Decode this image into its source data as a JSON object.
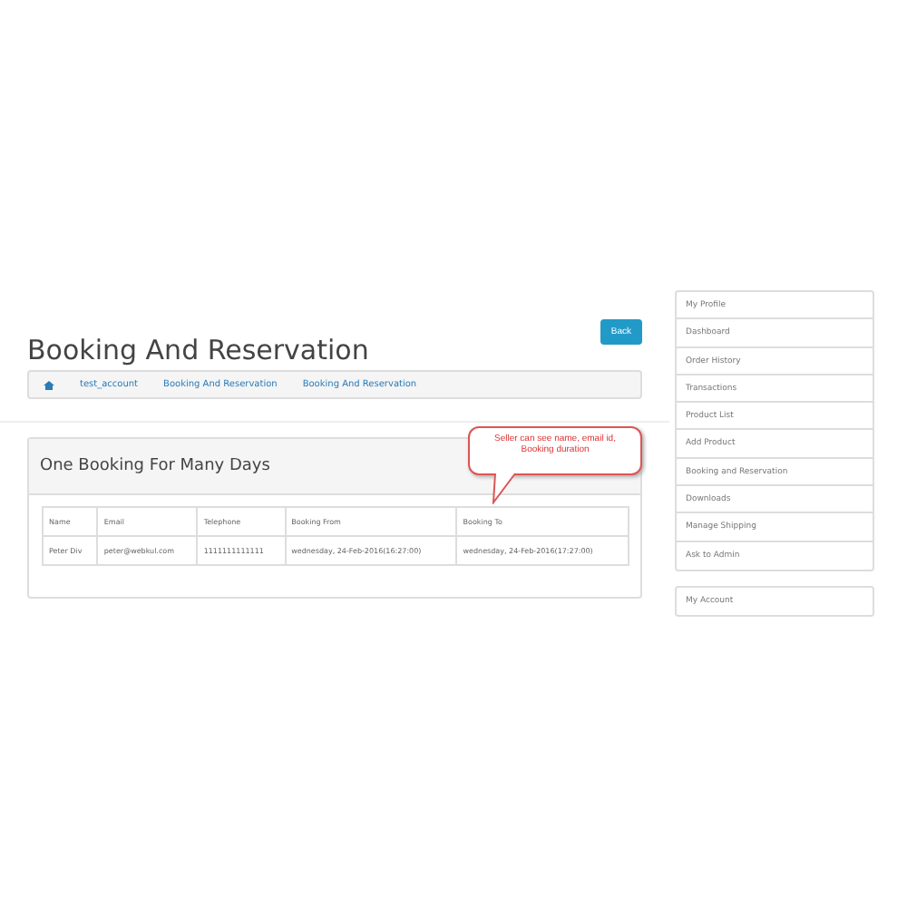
{
  "page_title": "Booking And Reservation",
  "back_button": "Back",
  "breadcrumb": [
    "test_account",
    "Booking And Reservation",
    "Booking And Reservation"
  ],
  "panel": {
    "title": "One Booking For Many Days",
    "table": {
      "columns": [
        "Name",
        "Email",
        "Telephone",
        "Booking From",
        "Booking To"
      ],
      "rows": [
        [
          "Peter Div",
          "peter@webkul.com",
          "1111111111111",
          "wednesday, 24-Feb-2016(16:27:00)",
          "wednesday, 24-Feb-2016(17:27:00)"
        ]
      ]
    }
  },
  "callout": "Seller can see name, email id, Booking duration",
  "sidebar": {
    "groups": [
      [
        "My Profile",
        "Dashboard",
        "Order History",
        "Transactions",
        "Product List",
        "Add Product",
        "Booking and Reservation",
        "Downloads",
        "Manage Shipping",
        "Ask to Admin"
      ],
      [
        "My Account"
      ]
    ]
  }
}
